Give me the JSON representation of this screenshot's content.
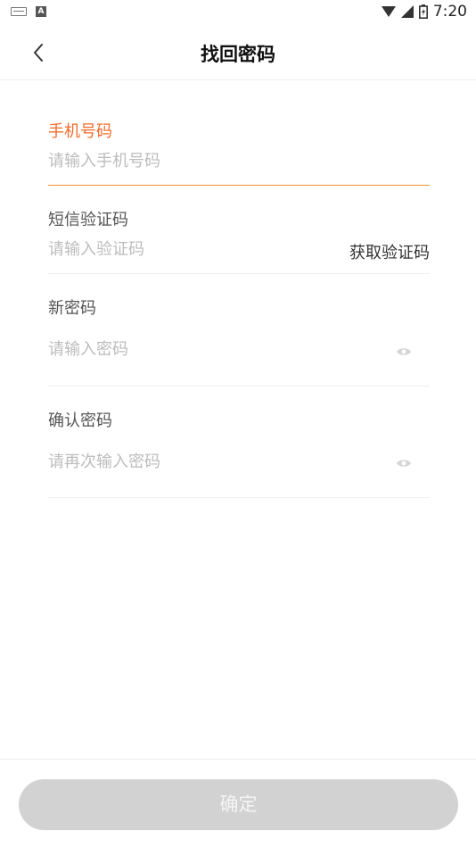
{
  "status_bar": {
    "time": "7:20",
    "a_badge": "A"
  },
  "header": {
    "title": "找回密码"
  },
  "form": {
    "phone": {
      "label": "手机号码",
      "placeholder": "请输入手机号码",
      "value": ""
    },
    "sms_code": {
      "label": "短信验证码",
      "placeholder": "请输入验证码",
      "value": "",
      "get_code_label": "获取验证码"
    },
    "new_password": {
      "label": "新密码",
      "placeholder": "请输入密码",
      "value": ""
    },
    "confirm_password": {
      "label": "确认密码",
      "placeholder": "请再次输入密码",
      "value": ""
    }
  },
  "footer": {
    "confirm_label": "确定"
  },
  "colors": {
    "accent": "#f26b2a",
    "underline_active": "#f0932e",
    "button_disabled": "#d2d2d2"
  },
  "icons": {
    "back": "chevron-left-icon",
    "eye": "eye-icon"
  }
}
